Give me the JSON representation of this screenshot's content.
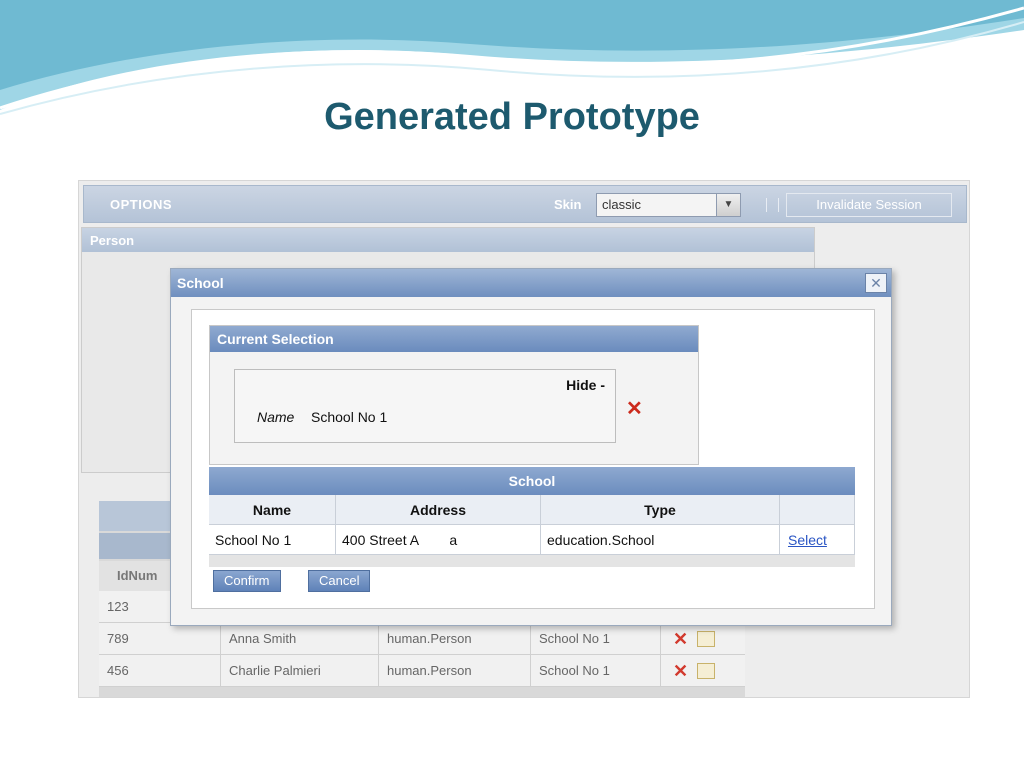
{
  "slide": {
    "title": "Generated Prototype"
  },
  "toolbar": {
    "options_label": "OPTIONS",
    "skin_label": "Skin",
    "skin_value": "classic",
    "invalidate_label": "Invalidate Session"
  },
  "person_panel": {
    "title": "Person"
  },
  "background_table": {
    "header_first": "IdNum",
    "rows": [
      {
        "id": "123"
      },
      {
        "id": "789",
        "name": "Anna Smith",
        "type": "human.Person",
        "school": "School No 1"
      },
      {
        "id": "456",
        "name": "Charlie Palmieri",
        "type": "human.Person",
        "school": "School No 1"
      }
    ]
  },
  "modal": {
    "title": "School",
    "close_icon": "close-icon",
    "current_selection": {
      "title": "Current Selection",
      "hide_label": "Hide -",
      "name_label": "Name",
      "name_value": "School No 1"
    },
    "school_table": {
      "caption": "School",
      "columns": [
        "Name",
        "Address",
        "Type",
        ""
      ],
      "rows": [
        {
          "name": "School No 1",
          "address": "400 Street A        a",
          "type": "education.School",
          "action": "Select"
        }
      ]
    },
    "confirm_label": "Confirm",
    "cancel_label": "Cancel"
  },
  "colors": {
    "title": "#1d5a6e",
    "header_blue": "#6f8fbf",
    "remove_red": "#cc2a1c",
    "link": "#2a55c4"
  }
}
